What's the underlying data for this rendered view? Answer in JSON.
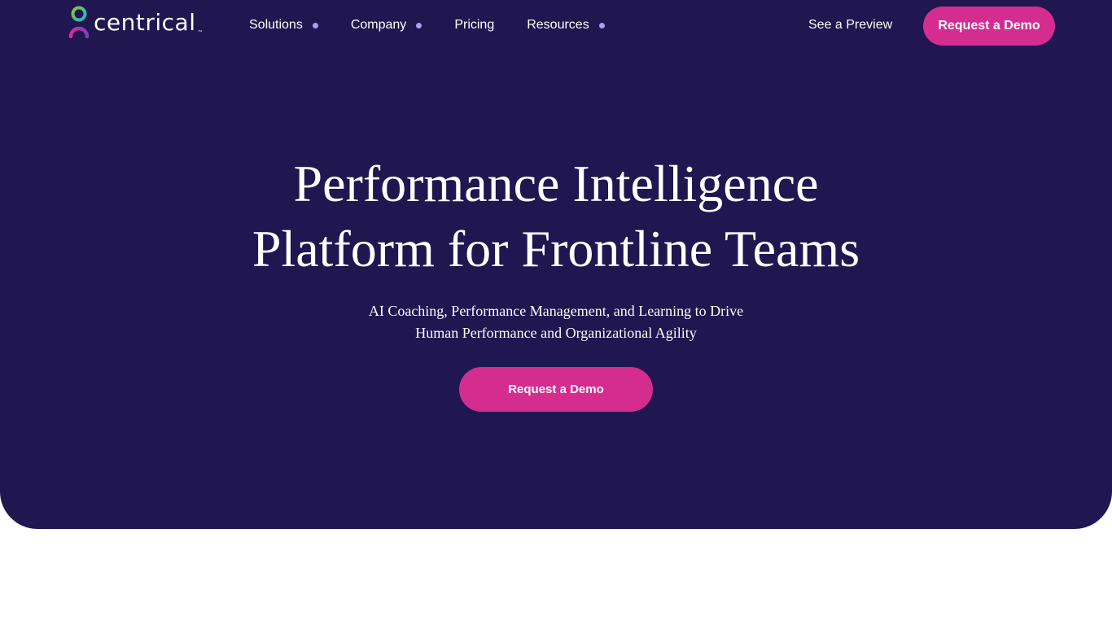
{
  "brand": {
    "name": "centrical",
    "tm": "™",
    "colors": {
      "background": "#201650",
      "accent": "#d42d8f",
      "nav_dot": "#a89ff2",
      "logo_green": "#8bc53f",
      "logo_blue": "#1fb5c9",
      "logo_pink": "#d42d8f",
      "logo_purple": "#7b3fbf"
    }
  },
  "nav": {
    "items": [
      {
        "label": "Solutions",
        "has_dropdown": true
      },
      {
        "label": "Company",
        "has_dropdown": true
      },
      {
        "label": "Pricing",
        "has_dropdown": false
      },
      {
        "label": "Resources",
        "has_dropdown": true
      }
    ],
    "preview_label": "See a Preview",
    "demo_label": "Request a Demo"
  },
  "hero": {
    "headline_line1": "Performance Intelligence",
    "headline_line2": "Platform for Frontline Teams",
    "subhead_line1": "AI Coaching, Performance Management, and Learning to Drive",
    "subhead_line2": "Human Performance and Organizational Agility",
    "cta_label": "Request a Demo"
  }
}
